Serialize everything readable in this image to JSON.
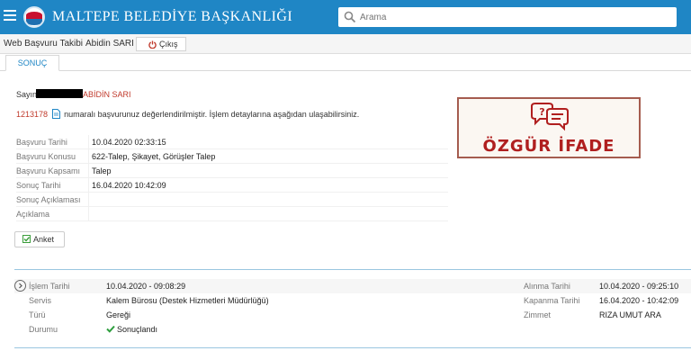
{
  "header": {
    "title": "MALTEPE BELEDİYE BAŞKANLIĞI",
    "search_placeholder": "Arama",
    "brand_color": "#1f86c5"
  },
  "subbar": {
    "app_name": "Web Başvuru Takibi",
    "user_name": "Abidin SARI",
    "logout_label": "Çıkış"
  },
  "tabs": [
    {
      "label": "SONUÇ",
      "active": true
    }
  ],
  "result": {
    "salutation": "Sayın",
    "name_suffix": "ABİDİN SARI",
    "application_no": "1213178",
    "message": "numaralı başvurunuz değerlendirilmiştir. İşlem detaylarına aşağıdan ulaşabilirsiniz.",
    "fields": [
      {
        "label": "Başvuru Tarihi",
        "value": "10.04.2020 02:33:15"
      },
      {
        "label": "Başvuru Konusu",
        "value": "622-Talep, Şikayet, Görüşler Talep"
      },
      {
        "label": "Başvuru Kapsamı",
        "value": "Talep"
      },
      {
        "label": "Sonuç Tarihi",
        "value": "16.04.2020 10:42:09"
      },
      {
        "label": "Sonuç Açıklaması",
        "value": ""
      },
      {
        "label": "Açıklama",
        "value": ""
      }
    ],
    "survey_label": "Anket"
  },
  "overlay_image": {
    "text": "ÖZGÜR İFADE"
  },
  "process": {
    "left": [
      {
        "label": "İşlem Tarihi",
        "value": "10.04.2020 - 09:08:29"
      },
      {
        "label": "Servis",
        "value": "Kalem Bürosu (Destek Hizmetleri Müdürlüğü)"
      },
      {
        "label": "Türü",
        "value": "Gereği"
      },
      {
        "label": "Durumu",
        "value": "Sonuçlandı"
      }
    ],
    "right": [
      {
        "label": "Alınma Tarihi",
        "value": "10.04.2020 - 09:25:10"
      },
      {
        "label": "Kapanma Tarihi",
        "value": "16.04.2020 - 10:42:09"
      },
      {
        "label": "Zimmet",
        "value": "RIZA UMUT ARA"
      }
    ]
  }
}
